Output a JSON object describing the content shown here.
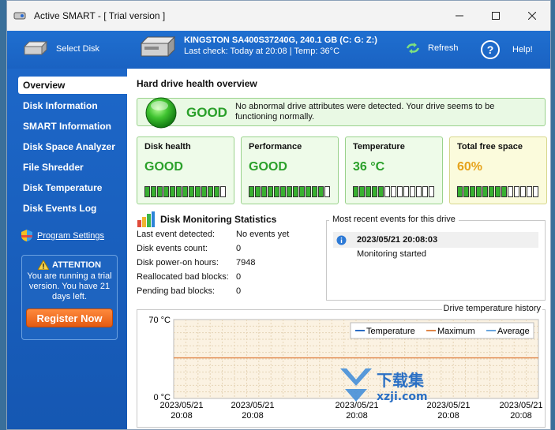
{
  "window": {
    "title": "Active SMART - [ Trial version ]"
  },
  "toolbar": {
    "select_disk": "Select Disk",
    "disk_name": "KINGSTON SA400S37240G, 240.1 GB (C: G: Z:)",
    "last_check": "Last check: Today at 20:08 | Temp: 36°C",
    "refresh": "Refresh",
    "help": "Help!"
  },
  "sidebar": {
    "items": [
      {
        "label": "Overview",
        "active": true
      },
      {
        "label": "Disk Information"
      },
      {
        "label": "SMART Information"
      },
      {
        "label": "Disk Space Analyzer"
      },
      {
        "label": "File Shredder"
      },
      {
        "label": "Disk Temperature"
      },
      {
        "label": "Disk Events Log"
      }
    ],
    "program_settings": "Program Settings",
    "attention": {
      "title": "ATTENTION",
      "message": "You are running a trial version. You have 21 days left.",
      "register": "Register Now"
    }
  },
  "overview": {
    "title": "Hard drive health overview",
    "status": "GOOD",
    "status_desc": "No abnormal drive attributes were detected. Your drive seems to be functioning normally.",
    "cards": [
      {
        "label": "Disk health",
        "value": "GOOD",
        "level": 0.9
      },
      {
        "label": "Performance",
        "value": "GOOD",
        "level": 0.9
      },
      {
        "label": "Temperature",
        "value": "36 °C",
        "level": 0.4
      },
      {
        "label": "Total free space",
        "value": "60%",
        "level": 0.6
      }
    ]
  },
  "stats": {
    "title": "Disk Monitoring Statistics",
    "rows": [
      {
        "key": "Last event detected:",
        "value": "No events yet"
      },
      {
        "key": "Disk events count:",
        "value": "0"
      },
      {
        "key": "Disk power-on hours:",
        "value": "7948"
      },
      {
        "key": "Reallocated bad blocks:",
        "value": "0"
      },
      {
        "key": "Pending bad blocks:",
        "value": "0"
      }
    ]
  },
  "events": {
    "title": "Most recent events for this drive",
    "items": [
      {
        "time": "2023/05/21 20:08:03",
        "message": "Monitoring started"
      }
    ]
  },
  "chart_data": {
    "type": "line",
    "title": "Drive temperature history",
    "y_unit": "°C",
    "ylim": [
      0,
      70
    ],
    "y_ticks": [
      "70 °C",
      "0 °C"
    ],
    "x_ticks": [
      [
        "2023/05/21",
        "20:08"
      ],
      [
        "2023/05/21",
        "20:08"
      ],
      [
        "2023/05/21",
        "20:08"
      ],
      [
        "2023/05/21",
        "20:08"
      ],
      [
        "2023/05/21",
        "20:08"
      ]
    ],
    "legend": [
      "Temperature",
      "Maximum",
      "Average"
    ],
    "legend_position": "top-right",
    "series": [
      {
        "name": "Maximum",
        "values": [
          36,
          36
        ]
      }
    ],
    "colors": {
      "Temperature": "#2b6cc4",
      "Maximum": "#e0864a",
      "Average": "#6aa6de"
    },
    "grid": true
  },
  "watermark": {
    "text": "下载集",
    "sub": "xzji.com"
  }
}
